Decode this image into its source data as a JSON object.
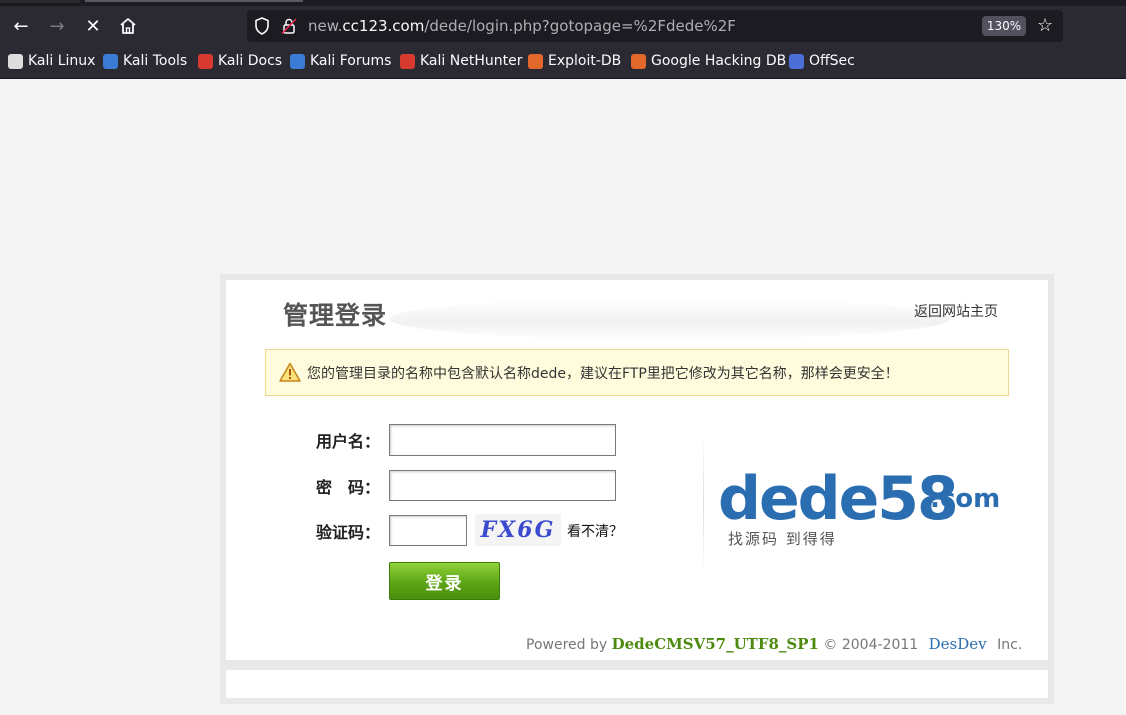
{
  "browser": {
    "url_prefix": "new.",
    "url_host": "cc123.com",
    "url_path": "/dede/login.php?gotopage=%2Fdede%2F",
    "zoom": "130%",
    "bookmarks": [
      {
        "label": "Kali Linux",
        "icon": "kali-dragon-icon",
        "color": "#dddddd"
      },
      {
        "label": "Kali Tools",
        "icon": "kali-tools-icon",
        "color": "#3a7bd5"
      },
      {
        "label": "Kali Docs",
        "icon": "kali-docs-icon",
        "color": "#d63a2e"
      },
      {
        "label": "Kali Forums",
        "icon": "kali-forums-icon",
        "color": "#3a7bd5"
      },
      {
        "label": "Kali NetHunter",
        "icon": "kali-nethunter-icon",
        "color": "#d63a2e"
      },
      {
        "label": "Exploit-DB",
        "icon": "exploit-db-icon",
        "color": "#e2672a"
      },
      {
        "label": "Google Hacking DB",
        "icon": "ghdb-icon",
        "color": "#e2672a"
      },
      {
        "label": "OffSec",
        "icon": "offsec-icon",
        "color": "#4b6fd6"
      }
    ]
  },
  "page": {
    "title": "管理登录",
    "back_home": "返回网站主页",
    "notice": "您的管理目录的名称中包含默认名称dede，建议在FTP里把它修改为其它名称，那样会更安全！",
    "username_label": "用户名：",
    "password_label": "密　码：",
    "captcha_label": "验证码：",
    "captcha_text": "FX6G",
    "cant_see": "看不清？",
    "login_button": "登录",
    "logo_main": "dede58",
    "logo_tld": ".com",
    "logo_sub": "找源码 到得得",
    "footer": {
      "powered": "Powered by",
      "brand": "DedeCMSV57_UTF8_SP1",
      "copyright": "© 2004-2011",
      "dev": "DesDev",
      "inc": "Inc."
    }
  },
  "colors": {
    "accent_green": "#5ca515",
    "brand_blue": "#2a6db0",
    "notice_bg": "#fefcdc"
  }
}
